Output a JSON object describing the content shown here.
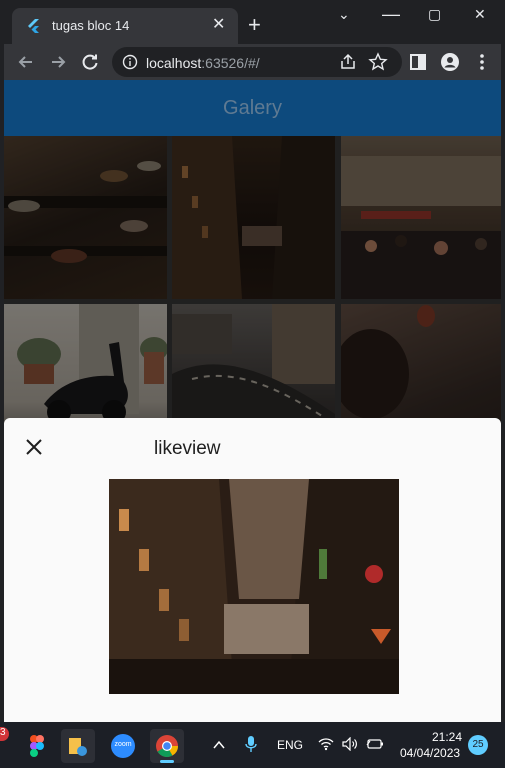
{
  "browser": {
    "tab_title": "tugas bloc 14",
    "tab_close": "✕",
    "new_tab": "+",
    "url_host": "localhost",
    "url_rest": ":63526/#/",
    "minimize": "⌄",
    "restore": "▢",
    "close": "✕",
    "icons": [
      "back-icon",
      "forward-icon",
      "reload-icon",
      "info-icon",
      "share-icon",
      "bookmark-star-icon",
      "sidepanel-icon",
      "profile-icon",
      "menu-dots-icon"
    ]
  },
  "app": {
    "title": "Galery",
    "accent": "#0d4a7d"
  },
  "sheet": {
    "title": "likeview",
    "close_glyph": "✕"
  },
  "taskbar": {
    "notification_count": "3",
    "zoom_label": "zoom",
    "language": "ENG",
    "time": "21:24",
    "date": "04/04/2023",
    "badge": "25"
  }
}
